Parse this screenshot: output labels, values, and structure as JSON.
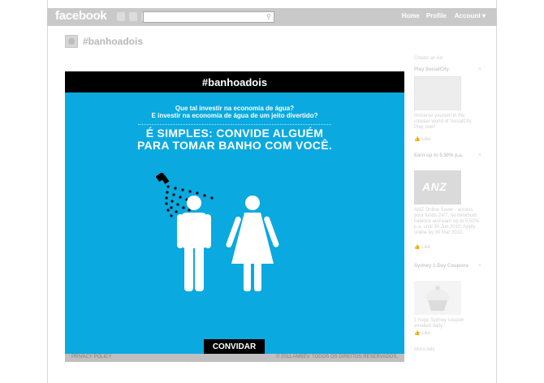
{
  "fb": {
    "logo": "facebook",
    "nav": {
      "home": "Home",
      "profile": "Profile",
      "account": "Account ▾"
    }
  },
  "page": {
    "title": "#banhoadois"
  },
  "app": {
    "header": "#banhoadois",
    "question_line1": "Que tal investir na economia de água?",
    "question_line2": "E investir na economia de água de um jeito divertido?",
    "headline_line1": "É SIMPLES: CONVIDE ALGUÉM",
    "headline_line2": "PARA TOMAR BANHO COM VOCÊ.",
    "invite_label": "CONVIDAR",
    "privacy": "PRIVACY POLICY",
    "copyright": "© 2011 AMBEV. TODOS OS DIREITOS RESERVADOS."
  },
  "sidebar": {
    "create_ad": "Create an Ad",
    "ads": [
      {
        "title": "Play SocialCity",
        "body": "Immerse yourself in the utopian world of SocialCity. Play now!",
        "like": "Like"
      },
      {
        "title": "Earn up to 5.50% p.a.",
        "image_text": "ANZ",
        "body": "ANZ Online Saver - access your funds 24/7, no minimum balance and earn up to 5.50% p.a. until 30 Jun 2010. Apply online by 30 Mar 2010.",
        "like": "Like"
      },
      {
        "title": "Sydney 1-Day Coupons",
        "body": "1 huge Sydney coupon emailed daily.",
        "like": "Like"
      }
    ],
    "more_ads": "More Ads"
  },
  "colors": {
    "app_blue": "#0aa9df",
    "black": "#000000",
    "bar_gray": "#c9c9c9"
  }
}
